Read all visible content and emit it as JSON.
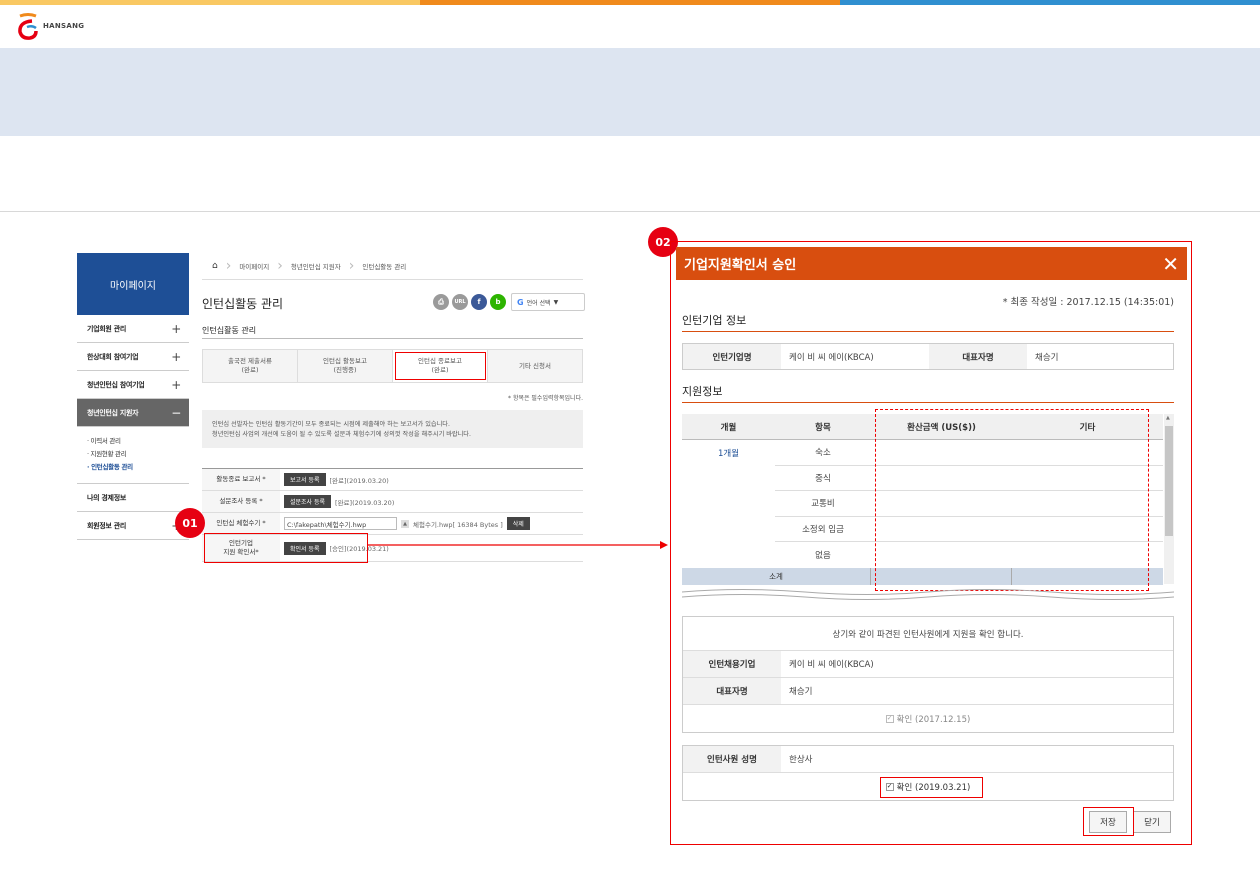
{
  "colors": {
    "stripe": [
      "#f9c863",
      "#f08a1c",
      "#2f8fd0"
    ],
    "sidebar_head": "#1e4f96",
    "modal_head": "#d84e0f",
    "highlight": "#e60012"
  },
  "logo": {
    "text": "HANSANG"
  },
  "sidebar": {
    "title": "마이페이지",
    "items": [
      {
        "label": "기업회원 관리",
        "toggle": "+"
      },
      {
        "label": "한상대회 참여기업",
        "toggle": "+"
      },
      {
        "label": "청년인턴십 참여기업",
        "toggle": "+"
      },
      {
        "label": "청년인턴십 지원자",
        "toggle": "−"
      }
    ],
    "sub_items": [
      "· 이력서 관리",
      "· 지원현황 관리",
      "· 인턴십활동 관리"
    ],
    "items_after": [
      {
        "label": "나의 경제정보",
        "toggle": ""
      },
      {
        "label": "회원정보 관리",
        "toggle": "+"
      }
    ]
  },
  "breadcrumb": [
    "마이페이지",
    "청년인턴십 지원자",
    "인턴십활동 관리"
  ],
  "main": {
    "title": "인턴십활동 관리",
    "subtitle": "인턴십활동 관리",
    "share": {
      "print": "프린트",
      "url": "URL",
      "fb": "f",
      "blog": "b",
      "translate": "언어 선택",
      "translate_arrow": "▼"
    },
    "tabs": [
      {
        "line1": "출국전 제출서류",
        "line2": "(완료)"
      },
      {
        "line1": "인턴십 활동보고",
        "line2": "(진행중)"
      },
      {
        "line1": "인턴십 종료보고",
        "line2": "(완료)"
      },
      {
        "line1": "기타 신청서",
        "line2": ""
      }
    ],
    "required_note": "* 항목은 필수입력항목입니다.",
    "info_lines": [
      "인턴십 선발자는 인턴십 활동기간이 모두 종료되는 시점에 제출해야 하는 보고서가 있습니다.",
      "청년인턴십 사업의 개선에 도움이 될 수 있도록 설문과 체험수기에 성의껏 작성을 해주시기 바랍니다."
    ],
    "form_rows": [
      {
        "label": "활동종료 보고서 *",
        "button": "보고서 등록",
        "status": "[완료](2019.03.20)"
      },
      {
        "label": "설문조사 등록 *",
        "button": "설문조사 등록",
        "status": "[완료](2019.03.20)"
      },
      {
        "label": "인턴십 체험수기 *",
        "input": "C:\\fakepath\\체험수기.hwp",
        "file": "체험수기.hwp[ 16384 Bytes ]",
        "button": "삭제"
      },
      {
        "label_line1": "인턴기업",
        "label_line2": "지원 확인서*",
        "button": "확인서 등록",
        "status": "[승인](2019.03.21)"
      }
    ]
  },
  "markers": {
    "m1": "01",
    "m2": "02"
  },
  "modal": {
    "title": "기업지원확인서 승인",
    "close": "✕",
    "last_written": "* 최종 작성일 : 2017.12.15 (14:35:01)",
    "company_section": "인턴기업 정보",
    "company_label": "인턴기업명",
    "company_value": "케이 비 씨 에이(KBCA)",
    "rep_label": "대표자명",
    "rep_value": "채승기",
    "support_section": "지원정보",
    "support_headers": [
      "개월",
      "항목",
      "환산금액 (US($))",
      "기타"
    ],
    "month": "1개월",
    "support_items": [
      "숙소",
      "중식",
      "교통비",
      "소정외 임금",
      "없음"
    ],
    "subtotal": "소계",
    "confirm_note": "상기와 같이 파견된 인턴사원에게 지원을 확인 합니다.",
    "employer_label": "인턴채용기업",
    "employer_value": "케이 비 씨 에이(KBCA)",
    "employer_rep_label": "대표자명",
    "employer_rep_value": "채승기",
    "employer_confirm": "확인 (2017.12.15)",
    "intern_label": "인턴사원 성명",
    "intern_value": "한상사",
    "intern_confirm": "확인 (2019.03.21)",
    "save": "저장",
    "close_btn": "닫기"
  }
}
